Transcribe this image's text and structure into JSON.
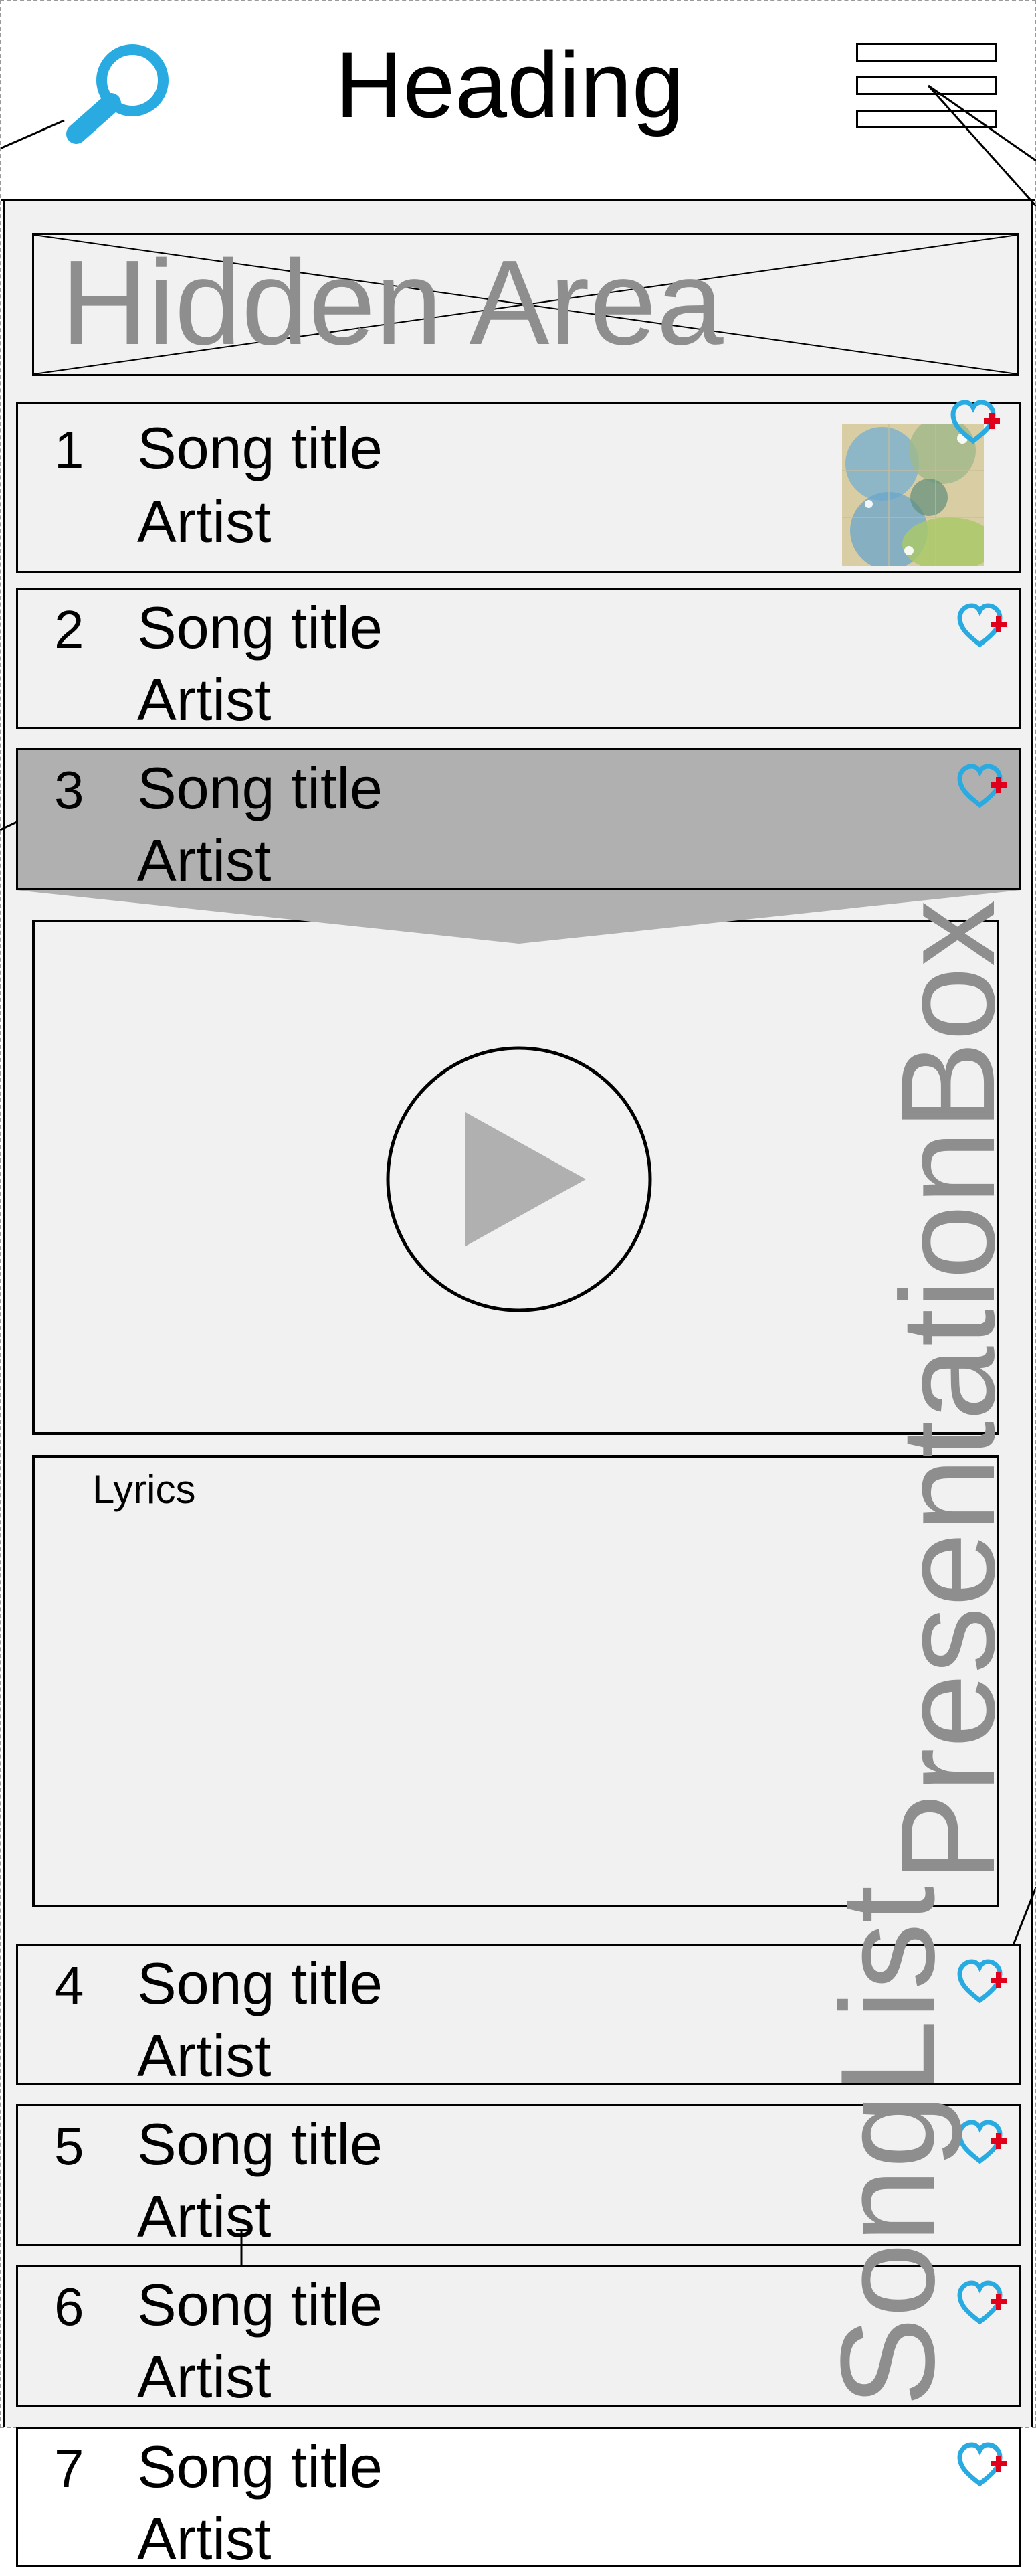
{
  "header": {
    "title": "Heading",
    "search_icon": "search-icon",
    "menu_icon": "hamburger-menu-icon"
  },
  "hidden_area": {
    "label": "Hidden Area"
  },
  "songs": [
    {
      "number": "1",
      "title": "Song title",
      "artist": "Artist",
      "has_thumbnail": true
    },
    {
      "number": "2",
      "title": "Song title",
      "artist": "Artist"
    },
    {
      "number": "3",
      "title": "Song title",
      "artist": "Artist",
      "selected": true
    },
    {
      "number": "4",
      "title": "Song title",
      "artist": "Artist"
    },
    {
      "number": "5",
      "title": "Song title",
      "artist": "Artist"
    },
    {
      "number": "6",
      "title": "Song title",
      "artist": "Artist"
    },
    {
      "number": "7",
      "title": "Song title",
      "artist": "Artist"
    }
  ],
  "presentation": {
    "lyrics_label": "Lyrics",
    "side_label": "PresentationBox",
    "play_icon": "play-icon"
  },
  "songlist_label": "SongList",
  "colors": {
    "search_blue": "#29abe2",
    "heart_blue": "#29abe2",
    "plus_red": "#e0001b",
    "label_gray": "#8e8e8e",
    "selected_gray": "#b0b0b0",
    "panel_bg": "#f1f1f1"
  }
}
